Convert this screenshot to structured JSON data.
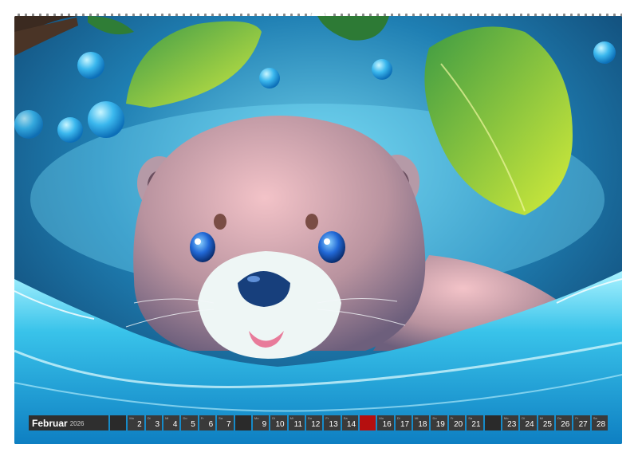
{
  "calendar": {
    "month": "Februar",
    "year": "2026",
    "days": [
      {
        "num": "",
        "wd": "",
        "type": "weekend"
      },
      {
        "num": "2",
        "wd": "Mo",
        "type": "day"
      },
      {
        "num": "3",
        "wd": "Di",
        "type": "day"
      },
      {
        "num": "4",
        "wd": "Mi",
        "type": "day"
      },
      {
        "num": "5",
        "wd": "Do",
        "type": "day"
      },
      {
        "num": "6",
        "wd": "Fr",
        "type": "day"
      },
      {
        "num": "7",
        "wd": "Sa",
        "type": "day"
      },
      {
        "num": "",
        "wd": "",
        "type": "weekend"
      },
      {
        "num": "9",
        "wd": "Mo",
        "type": "day"
      },
      {
        "num": "10",
        "wd": "Di",
        "type": "day"
      },
      {
        "num": "11",
        "wd": "Mi",
        "type": "day"
      },
      {
        "num": "12",
        "wd": "Do",
        "type": "day"
      },
      {
        "num": "13",
        "wd": "Fr",
        "type": "day"
      },
      {
        "num": "14",
        "wd": "Sa",
        "type": "day"
      },
      {
        "num": "",
        "wd": "",
        "type": "holiday"
      },
      {
        "num": "16",
        "wd": "Mo",
        "type": "day"
      },
      {
        "num": "17",
        "wd": "Di",
        "type": "day"
      },
      {
        "num": "18",
        "wd": "Mi",
        "type": "day"
      },
      {
        "num": "19",
        "wd": "Do",
        "type": "day"
      },
      {
        "num": "20",
        "wd": "Fr",
        "type": "day"
      },
      {
        "num": "21",
        "wd": "Sa",
        "type": "day"
      },
      {
        "num": "",
        "wd": "",
        "type": "weekend"
      },
      {
        "num": "23",
        "wd": "Mo",
        "type": "day"
      },
      {
        "num": "24",
        "wd": "Di",
        "type": "day"
      },
      {
        "num": "25",
        "wd": "Mi",
        "type": "day"
      },
      {
        "num": "26",
        "wd": "Do",
        "type": "day"
      },
      {
        "num": "27",
        "wd": "Fr",
        "type": "day"
      },
      {
        "num": "28",
        "wd": "Sa",
        "type": "day"
      }
    ]
  },
  "colors": {
    "strip": "#3a3a3a",
    "weekend": "#2a2a2a",
    "holiday": "#b50f0f",
    "text": "#ffffff"
  }
}
